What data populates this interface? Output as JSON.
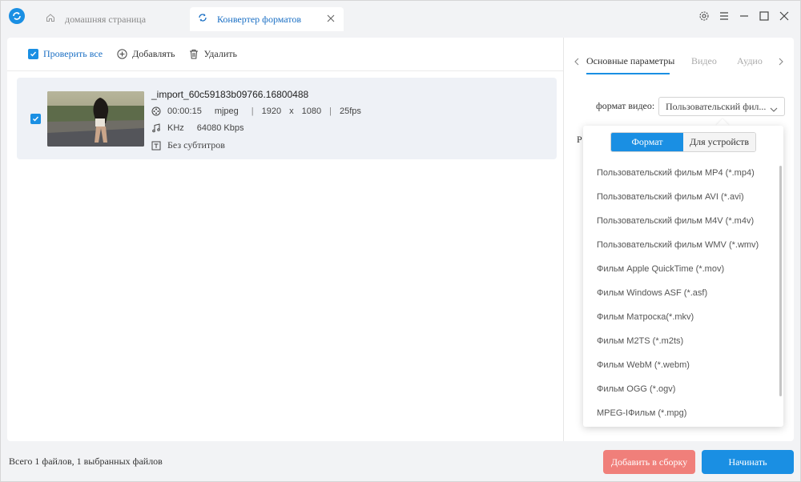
{
  "titlebar": {
    "tabs": [
      {
        "label": "домашняя страница",
        "active": false
      },
      {
        "label": "Конвертер форматов",
        "active": true
      }
    ]
  },
  "toolbar": {
    "check_all_label": "Проверить все",
    "add_label": "Добавлять",
    "delete_label": "Удалить"
  },
  "file": {
    "name": "_import_60c59183b09766.16800488",
    "duration": "00:00:15",
    "codec": "mjpeg",
    "sep": "|",
    "width": "1920",
    "x": "x",
    "height": "1080",
    "fps": "25fps",
    "audio": "KHz",
    "bitrate": "64080 Kbps",
    "subtitles": "Без субтитров"
  },
  "settings": {
    "tabs": [
      "Основные параметры",
      "Видео",
      "Аудио"
    ],
    "format_label": "формат видео:",
    "format_value": "Пользовательский фил...",
    "partial_label": "Р"
  },
  "dropdown": {
    "segments": [
      "Формат",
      "Для устройств"
    ],
    "items": [
      "Пользовательский фильм MP4 (*.mp4)",
      "Пользовательский фильм AVI (*.avi)",
      "Пользовательский фильм M4V (*.m4v)",
      "Пользовательский фильм WMV (*.wmv)",
      "Фильм Apple QuickTime (*.mov)",
      "Фильм Windows ASF (*.asf)",
      "Фильм Матроска(*.mkv)",
      "Фильм M2TS (*.m2ts)",
      "Фильм WebM (*.webm)",
      "Фильм OGG (*.ogv)",
      "MPEG-IФильм (*.mpg)"
    ]
  },
  "footer": {
    "status": "Всего 1 файлов, 1 выбранных файлов",
    "add_button": "Добавить в сборку",
    "start_button": "Начинать"
  },
  "colors": {
    "accent": "#1a8fe3",
    "add_button": "#f07f7a"
  }
}
